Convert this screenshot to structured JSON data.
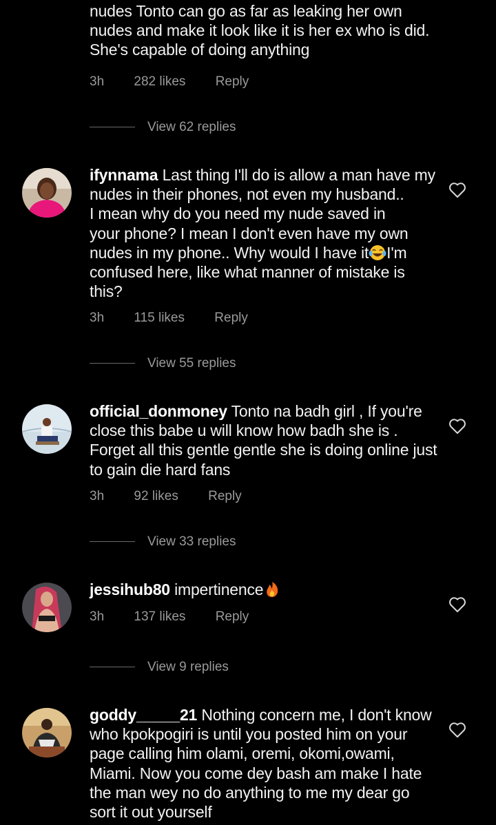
{
  "top_comment": {
    "lines": [
      "nudes Tonto can go as far as leaking her own",
      "nudes and make it look like it is her ex who is did.",
      "She's capable  of doing anything"
    ],
    "time": "3h",
    "likes": "282 likes",
    "reply": "Reply",
    "view_replies": "View 62 replies"
  },
  "comments": [
    {
      "username": "ifynnama",
      "lines": [
        " Last thing I'll do is allow a man have my",
        "nudes in their phones, not even my husband..",
        "I mean why do you need my nude saved in",
        "your phone? I mean I don't even have my own",
        "nudes in my phone.. Why would I have it",
        "confused here, like what manner of mistake is",
        "this?"
      ],
      "emoji_tail": "I'm",
      "time": "3h",
      "likes": "115 likes",
      "reply": "Reply",
      "view_replies": "View 55 replies"
    },
    {
      "username": "official_donmoney",
      "lines": [
        " Tonto na badh girl , If you're",
        "close this babe u will know how badh she is .",
        "Forget all this gentle gentle she is doing online just",
        "to gain die hard fans"
      ],
      "time": "3h",
      "likes": "92 likes",
      "reply": "Reply",
      "view_replies": "View 33 replies"
    },
    {
      "username": "jessihub80",
      "lines": [
        " impertinence"
      ],
      "time": "3h",
      "likes": "137 likes",
      "reply": "Reply",
      "view_replies": "View 9 replies"
    },
    {
      "username": "goddy_____21",
      "lines": [
        " Nothing concern me, I don't know",
        "who kpokpogiri is until you posted him on your",
        "page calling him olami, oremi, okomi,owami,",
        "Miami. Now you come dey bash am make I hate",
        "the man wey no do anything to me my dear go",
        "sort it out yourself"
      ]
    }
  ],
  "icons": {
    "like": "heart-outline-icon",
    "laugh_emoji": "face-with-tears-of-joy-emoji",
    "fire_emoji": "fire-emoji"
  },
  "colors": {
    "background": "#000000",
    "text": "#f2f2f2",
    "meta": "#9a9a9a"
  }
}
